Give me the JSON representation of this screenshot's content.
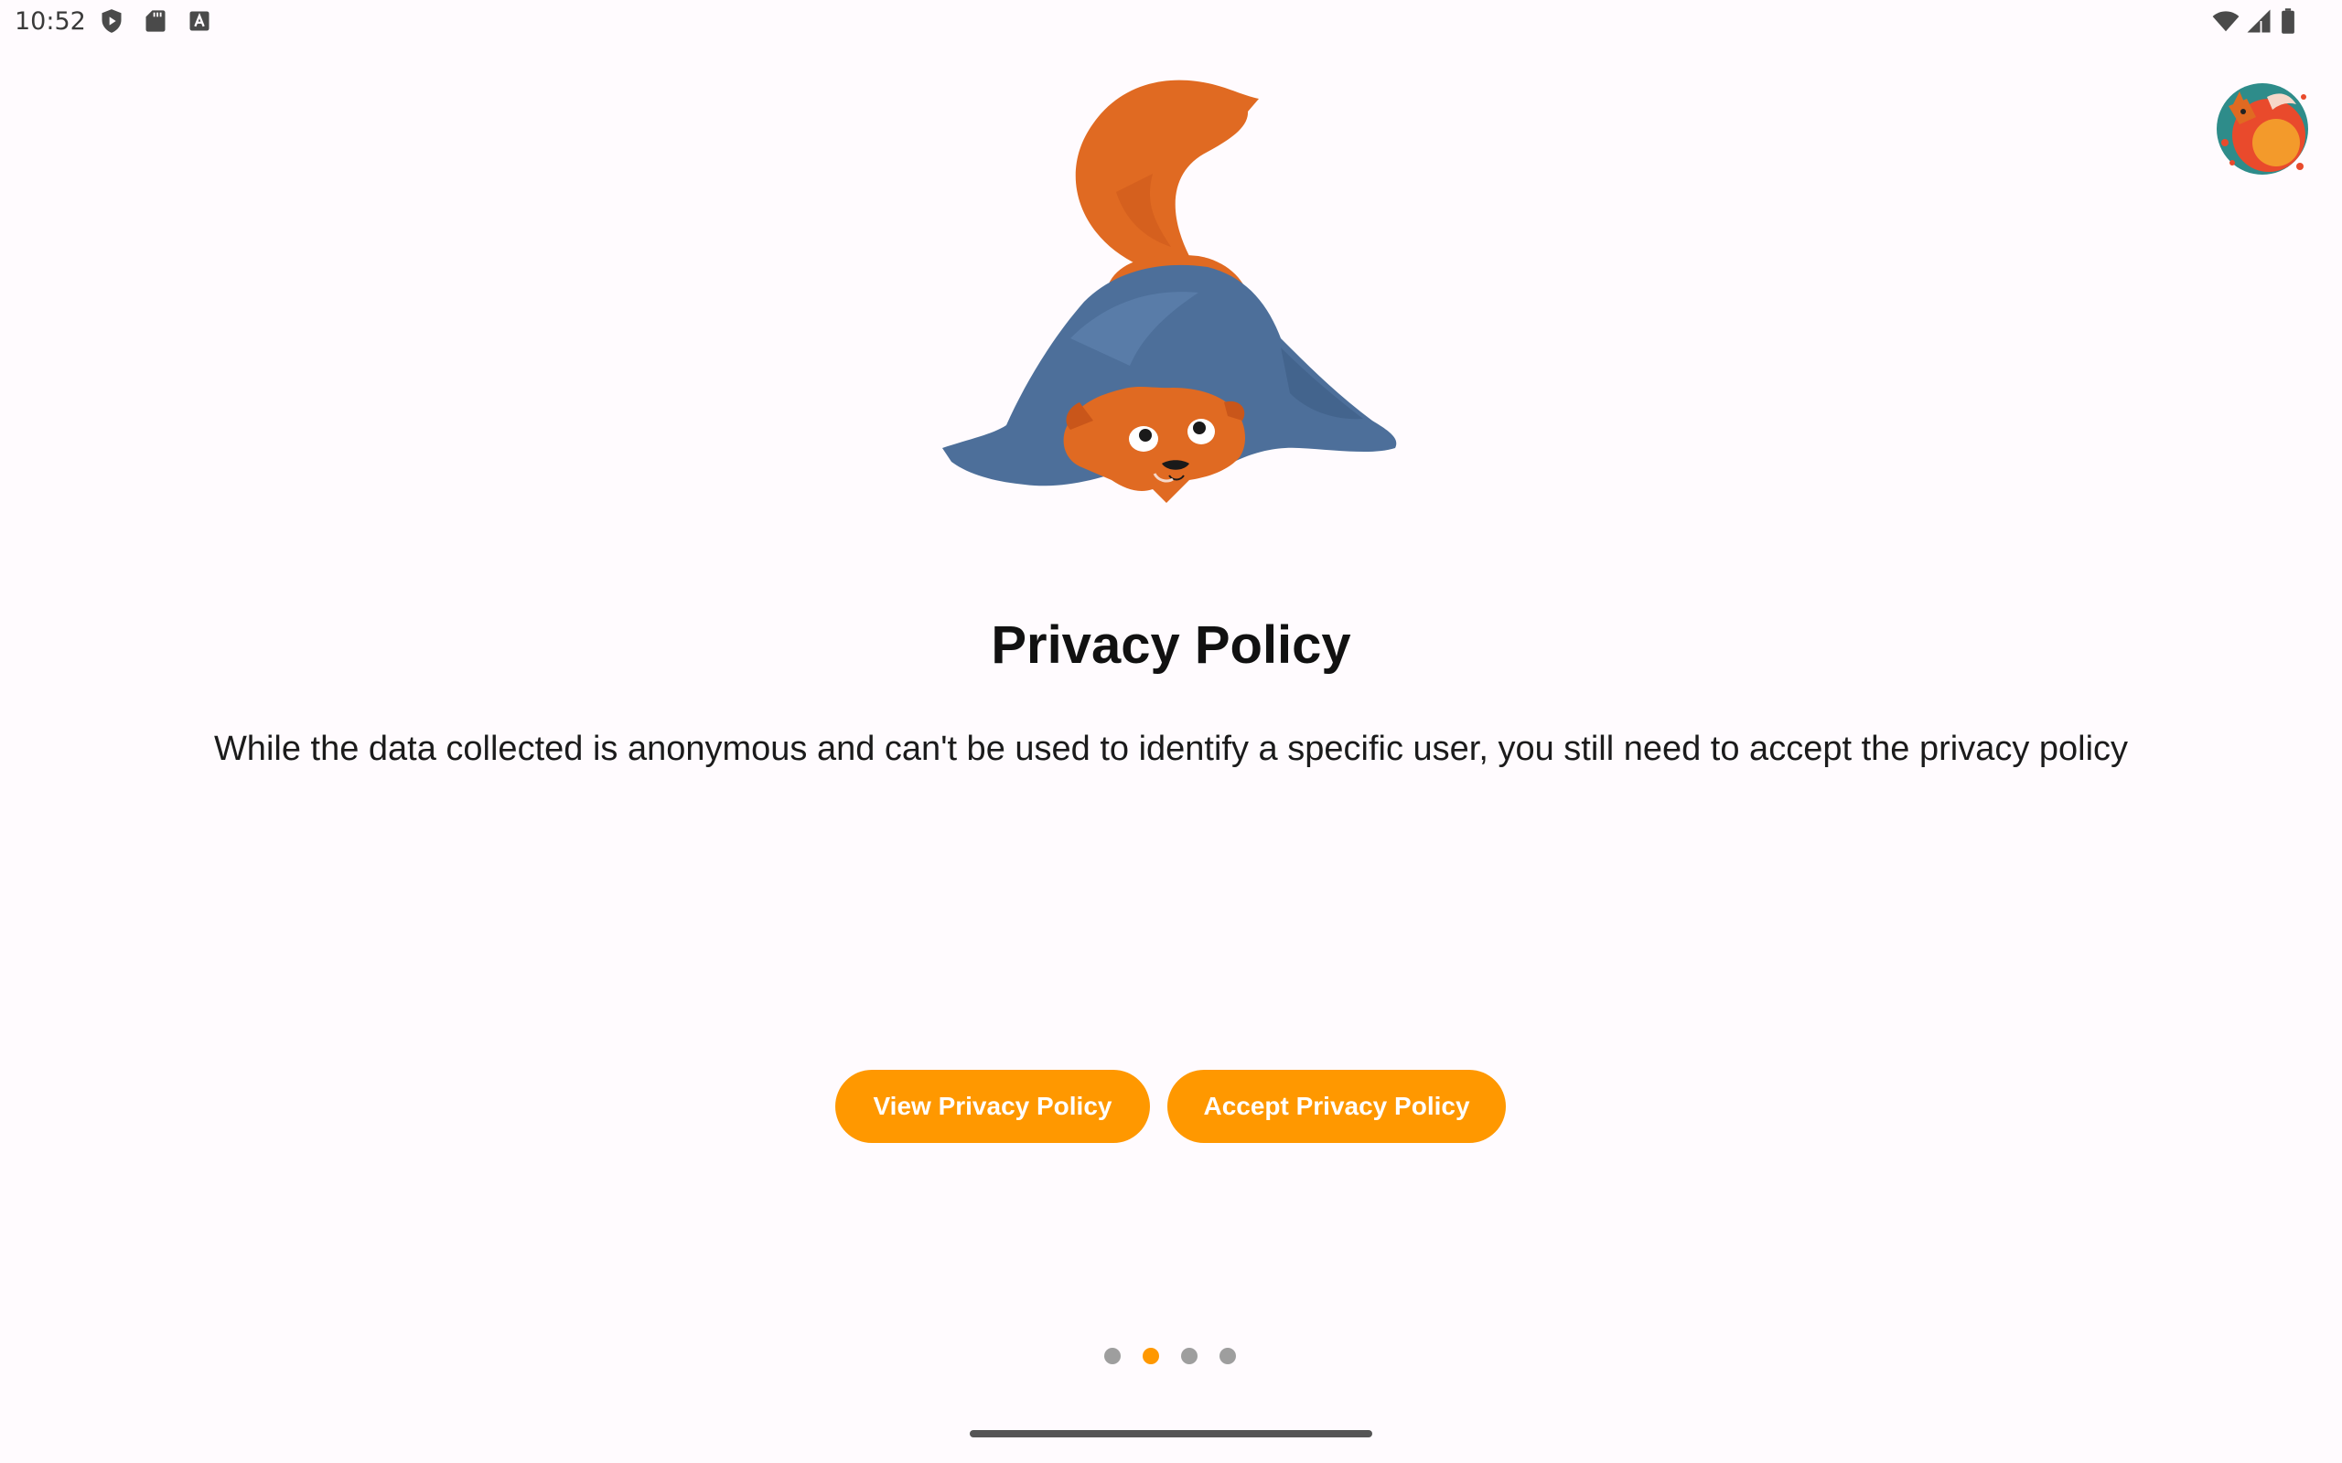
{
  "status_bar": {
    "time": "10:52",
    "left_icons": [
      "play-protect-icon",
      "sd-card-icon",
      "keyboard-a-icon"
    ],
    "right_icons": [
      "wifi-icon",
      "cell-signal-icon",
      "battery-icon"
    ]
  },
  "avatar": {
    "icon": "fox-avatar-icon"
  },
  "illustration": {
    "icon": "fox-under-blanket-illustration"
  },
  "onboarding": {
    "title": "Privacy Policy",
    "description": "While the data collected is anonymous and can't be used to identify a specific user, you still need to accept the privacy policy",
    "view_button": "View Privacy Policy",
    "accept_button": "Accept Privacy Policy"
  },
  "pager": {
    "page_count": 4,
    "current_page": 2
  },
  "colors": {
    "background": "#FFFBFE",
    "accent": "#FF9800",
    "dot_inactive": "#9E9E9E",
    "fox_orange": "#E06A22",
    "blanket_blue": "#4D6F9A"
  }
}
